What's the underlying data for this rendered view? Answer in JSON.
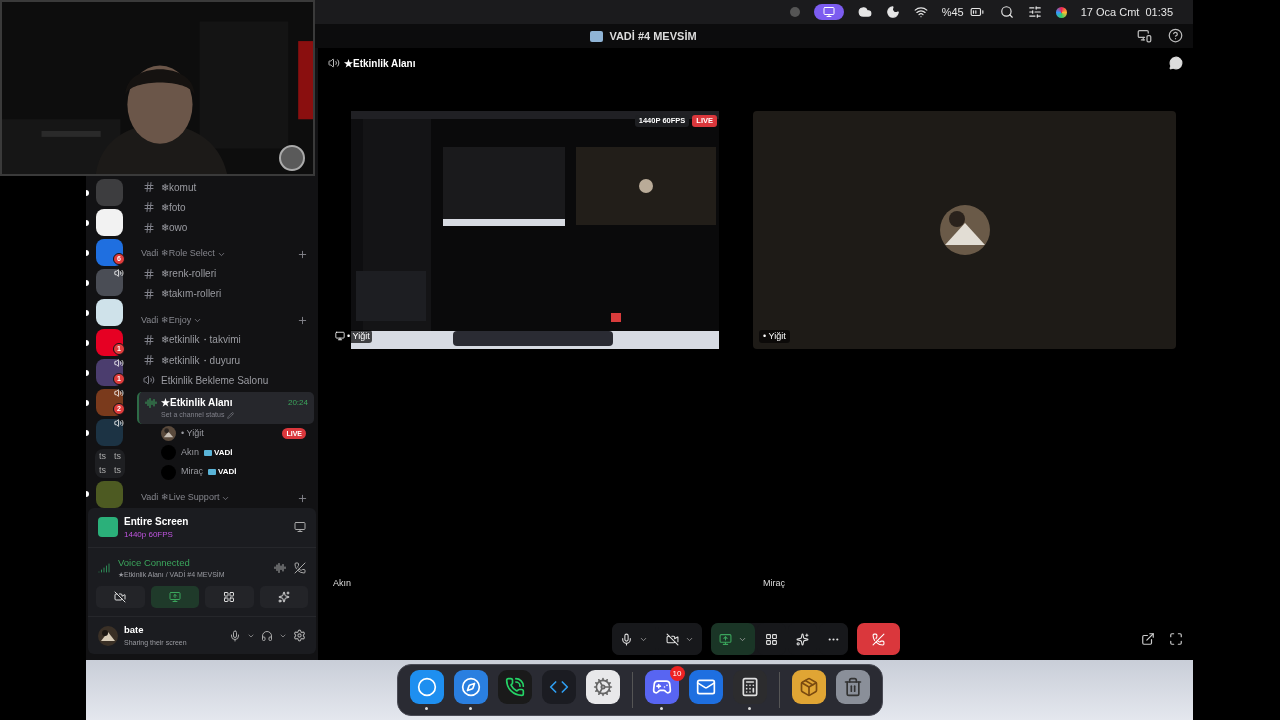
{
  "menubar": {
    "battery": "%45",
    "clock": "17 Oca Cmt  01:35"
  },
  "window": {
    "title": "VADİ #4 MEVSİM"
  },
  "servers": [
    {
      "kind": "server",
      "color": "#3d3d3f",
      "unread": true,
      "in_voice": false
    },
    {
      "kind": "server",
      "color": "#f2f2f2",
      "unread": true,
      "in_voice": false
    },
    {
      "kind": "server",
      "color": "#1f6fe0",
      "unread": true,
      "in_voice": false,
      "badge": "6"
    },
    {
      "kind": "server",
      "color": "#4a4d55",
      "unread": true,
      "in_voice": true
    },
    {
      "kind": "server",
      "color": "#cfe2ea",
      "unread": true,
      "in_voice": false
    },
    {
      "kind": "server",
      "color": "#e60023",
      "unread": true,
      "in_voice": false,
      "badge": "1"
    },
    {
      "kind": "server",
      "color": "#4b3d6e",
      "unread": true,
      "in_voice": true,
      "badge": "1"
    },
    {
      "kind": "server",
      "color": "#7a3a1c",
      "unread": true,
      "in_voice": true,
      "badge": "2"
    },
    {
      "kind": "server",
      "color": "#1c3344",
      "unread": true,
      "in_voice": true
    },
    {
      "kind": "folder",
      "labels": [
        "ts",
        "ts",
        "ts",
        "ts"
      ]
    },
    {
      "kind": "server",
      "color": "#4d5a22",
      "unread": true,
      "in_voice": false
    }
  ],
  "channels": [
    {
      "kind": "text",
      "name": "❄komut"
    },
    {
      "kind": "text",
      "name": "❄foto"
    },
    {
      "kind": "text",
      "name": "❄owo"
    },
    {
      "kind": "category",
      "name": "Vadi ❄Role Select"
    },
    {
      "kind": "text",
      "name": "❄renk-rolleri"
    },
    {
      "kind": "text",
      "name": "❄takım-rolleri"
    },
    {
      "kind": "category",
      "name": "Vadi ❄Enjoy"
    },
    {
      "kind": "text",
      "name": "❄etkinlik・takvimi"
    },
    {
      "kind": "text",
      "name": "❄etkinlik・duyuru"
    },
    {
      "kind": "voice",
      "name": "Etkinlik Bekleme Salonu"
    },
    {
      "kind": "voice_active",
      "name": "★Etkinlik Alanı",
      "time": "20:24",
      "status": "Set a channel status"
    },
    {
      "kind": "member",
      "name": "• Yiğit",
      "live": "LIVE"
    },
    {
      "kind": "member",
      "name": "Akın",
      "tag": "VADİ"
    },
    {
      "kind": "member",
      "name": "Miraç",
      "tag": "VADİ"
    },
    {
      "kind": "category",
      "name": "Vadi ❄Live Support"
    }
  ],
  "stream_panel": {
    "title": "Entire Screen",
    "quality": "1440p 60FPS"
  },
  "voice_panel": {
    "status": "Voice Connected",
    "location": "★Etkinlik Alanı / VADİ #4 MEVSİM",
    "buttons": [
      {
        "kind": "camera",
        "selected": false
      },
      {
        "kind": "screen",
        "selected": true
      },
      {
        "kind": "activities",
        "selected": false
      },
      {
        "kind": "soundboard",
        "selected": false
      }
    ]
  },
  "user_panel": {
    "name": "bate",
    "status": "Sharing their screen"
  },
  "call": {
    "channel": "★Etkinlik Alanı",
    "tiles": [
      {
        "kind": "stream",
        "name": "• Yiğit",
        "quality": "1440P 60FPS",
        "live": "LIVE"
      },
      {
        "kind": "camera",
        "name": "• Yiğit"
      }
    ],
    "participants": [
      {
        "name": "Akın"
      },
      {
        "name": "Miraç"
      }
    ],
    "controls": [
      {
        "kind": "mic",
        "selected": false
      },
      {
        "kind": "camera",
        "selected": false
      },
      {
        "kind": "screen",
        "selected": true
      },
      {
        "kind": "activities",
        "selected": false
      },
      {
        "kind": "soundboard",
        "selected": false
      },
      {
        "kind": "more",
        "selected": false
      },
      {
        "kind": "hangup"
      }
    ]
  },
  "dock": {
    "groups": [
      {
        "apps": [
          {
            "kind": "finder",
            "running": true
          },
          {
            "kind": "safari",
            "running": true
          },
          {
            "kind": "whatsapp",
            "running": false
          },
          {
            "kind": "vscode",
            "running": false
          },
          {
            "kind": "settings",
            "running": false
          }
        ]
      },
      {
        "apps": [
          {
            "kind": "discord",
            "running": true,
            "badge": "10"
          },
          {
            "kind": "mail",
            "running": false
          },
          {
            "kind": "calculator",
            "running": true
          }
        ]
      },
      {
        "apps": [
          {
            "kind": "box",
            "running": false
          },
          {
            "kind": "trash",
            "running": false
          }
        ]
      }
    ]
  }
}
